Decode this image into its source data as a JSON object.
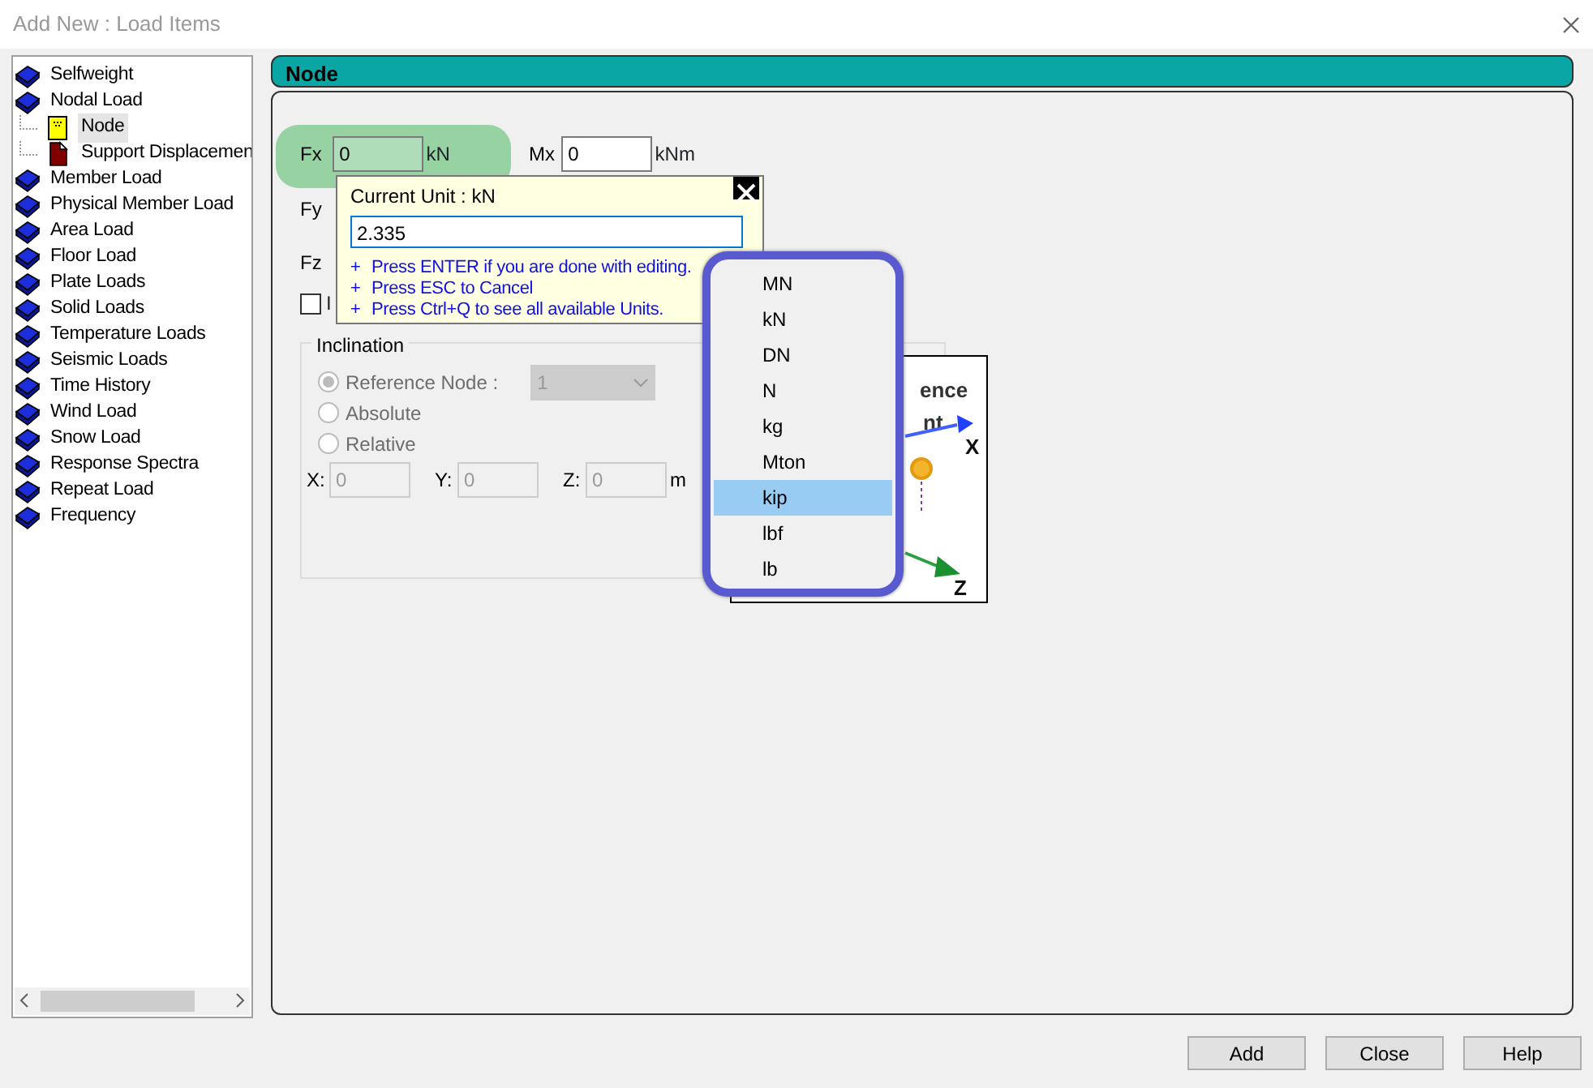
{
  "window": {
    "title": "Add New : Load Items"
  },
  "tree": [
    {
      "label": "Selfweight",
      "kind": "book",
      "selected": false
    },
    {
      "label": "Nodal Load",
      "kind": "book",
      "selected": false,
      "children": [
        {
          "label": "Node",
          "kind": "node",
          "selected": true
        },
        {
          "label": "Support Displacemen",
          "kind": "displacement",
          "selected": false
        }
      ]
    },
    {
      "label": "Member Load",
      "kind": "book",
      "selected": false
    },
    {
      "label": "Physical Member Load",
      "kind": "book",
      "selected": false
    },
    {
      "label": "Area Load",
      "kind": "book",
      "selected": false
    },
    {
      "label": "Floor Load",
      "kind": "book",
      "selected": false
    },
    {
      "label": "Plate Loads",
      "kind": "book",
      "selected": false
    },
    {
      "label": "Solid Loads",
      "kind": "book",
      "selected": false
    },
    {
      "label": "Temperature Loads",
      "kind": "book",
      "selected": false
    },
    {
      "label": "Seismic Loads",
      "kind": "book",
      "selected": false
    },
    {
      "label": "Time History",
      "kind": "book",
      "selected": false
    },
    {
      "label": "Wind Load",
      "kind": "book",
      "selected": false
    },
    {
      "label": "Snow Load",
      "kind": "book",
      "selected": false
    },
    {
      "label": "Response Spectra",
      "kind": "book",
      "selected": false
    },
    {
      "label": "Repeat Load",
      "kind": "book",
      "selected": false
    },
    {
      "label": "Frequency",
      "kind": "book",
      "selected": false
    }
  ],
  "panel": {
    "title": "Node",
    "force_row": [
      {
        "label": "Fx",
        "value": "0",
        "unit": "kN",
        "highlighted": true
      },
      {
        "label": "Mx",
        "value": "0",
        "unit": "kNm",
        "highlighted": false
      }
    ],
    "hidden_rows": [
      "Fy",
      "Fz"
    ],
    "checkbox": {
      "label": "I",
      "checked": false
    },
    "inclination": {
      "title": "Inclination",
      "disabled": true,
      "options": [
        {
          "label": "Reference Node :",
          "selected": true
        },
        {
          "label": "Absolute",
          "selected": false
        },
        {
          "label": "Relative",
          "selected": false
        }
      ],
      "reference_node": "1",
      "coords": [
        {
          "label": "X:",
          "value": "0"
        },
        {
          "label": "Y:",
          "value": "0"
        },
        {
          "label": "Z:",
          "value": "0"
        }
      ],
      "unit": "m"
    },
    "diagram": {
      "labels": [
        "ence",
        "nt"
      ],
      "axes": [
        "X",
        "Z"
      ]
    }
  },
  "unit_popup": {
    "title": "Current Unit : kN",
    "value": "2.335",
    "hints": [
      {
        "bullet": "+",
        "text": "Press ENTER if you are done with editing."
      },
      {
        "bullet": "+",
        "text": "Press ESC to Cancel"
      },
      {
        "bullet": "+",
        "text": "Press Ctrl+Q to see all available Units."
      }
    ]
  },
  "unit_menu": [
    {
      "label": "MN",
      "selected": false
    },
    {
      "label": "kN",
      "selected": false
    },
    {
      "label": "DN",
      "selected": false
    },
    {
      "label": "N",
      "selected": false
    },
    {
      "label": "kg",
      "selected": false
    },
    {
      "label": "Mton",
      "selected": false
    },
    {
      "label": "kip",
      "selected": true
    },
    {
      "label": "lbf",
      "selected": false
    },
    {
      "label": "lb",
      "selected": false
    }
  ],
  "buttons": [
    "Add",
    "Close",
    "Help"
  ]
}
